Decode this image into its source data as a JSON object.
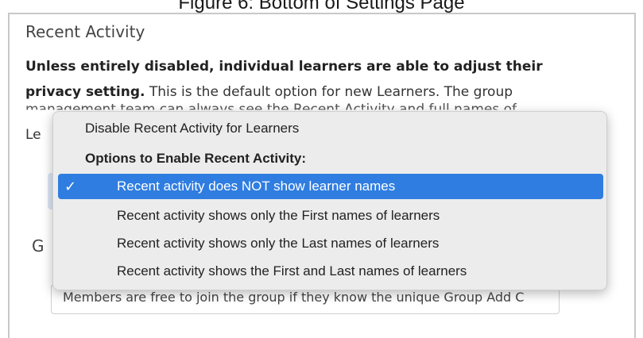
{
  "caption": "Figure 6: Bottom of Settings Page",
  "section": {
    "title": "Recent Activity",
    "desc_bold": "Unless entirely disabled, individual learners are able to adjust their privacy setting.",
    "desc_rest": " This is the default option for new Learners. The group",
    "desc_line3": "management team can always see the Recent Activity and full names of",
    "desc_line4": "Le"
  },
  "group": {
    "label": "G",
    "textbox_value": "Members are free to join the group if they know the unique Group Add C"
  },
  "dropdown": {
    "options": [
      {
        "label": "Disable Recent Activity for Learners",
        "type": "option"
      },
      {
        "label": "Options to Enable Recent Activity:",
        "type": "heading"
      },
      {
        "label": "Recent activity does NOT show learner names",
        "type": "option",
        "selected": true
      },
      {
        "label": "Recent activity shows only the First names of learners",
        "type": "option"
      },
      {
        "label": "Recent activity shows only the Last names of learners",
        "type": "option"
      },
      {
        "label": "Recent activity shows the First and Last names of learners",
        "type": "option"
      }
    ],
    "check_icon": "✓"
  },
  "colors": {
    "selected_bg": "#2f7de1",
    "menu_bg": "#ececec"
  }
}
